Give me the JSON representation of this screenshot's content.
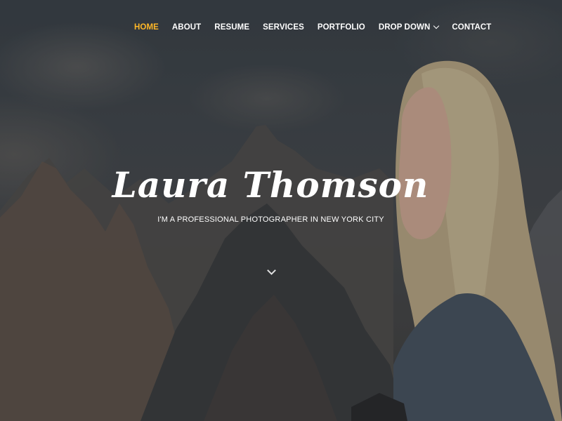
{
  "nav": {
    "items": [
      {
        "label": "HOME",
        "active": true
      },
      {
        "label": "ABOUT",
        "active": false
      },
      {
        "label": "RESUME",
        "active": false
      },
      {
        "label": "SERVICES",
        "active": false
      },
      {
        "label": "PORTFOLIO",
        "active": false
      },
      {
        "label": "DROP DOWN",
        "active": false,
        "has_dropdown": true
      },
      {
        "label": "CONTACT",
        "active": false
      }
    ],
    "active_color": "#ffb727",
    "text_color": "#ffffff"
  },
  "hero": {
    "title": "Laura Thomson",
    "subtitle": "I'M A PROFESSIONAL PHOTOGRAPHER IN NEW YORK CITY",
    "scroll_icon": "chevron-down-icon",
    "background_image": "mountains-and-woman-photo"
  }
}
